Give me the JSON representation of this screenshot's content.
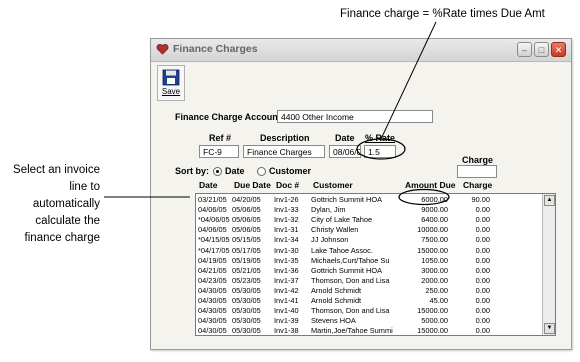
{
  "callouts": {
    "top": "Finance charge = %Rate times Due Amt",
    "left": [
      "Select an invoice",
      "line to",
      "automatically",
      "calculate the",
      "finance charge"
    ]
  },
  "window": {
    "title": "Finance Charges",
    "save_label": "Save"
  },
  "form": {
    "account_label": "Finance Charge Account*",
    "account_value": "4400   Other Income",
    "ref_label": "Ref #",
    "desc_label": "Description",
    "date_label": "Date",
    "rate_label": "% Rate",
    "ref_value": "FC-9",
    "desc_value": "Finance Charges",
    "date_value": "08/06/0",
    "rate_value": "1.5",
    "charge_label": "Charge",
    "charge_value": ""
  },
  "sort": {
    "label": "Sort by:",
    "option_date": "Date",
    "option_customer": "Customer",
    "selected": "Date"
  },
  "table": {
    "headers": [
      "Date",
      "Due Date",
      "Doc #",
      "Customer",
      "Amount Due",
      "Charge"
    ],
    "rows": [
      [
        "03/21/05",
        "04/20/05",
        "Inv1-26",
        "Gottrich Summit HOA",
        "6000.00",
        "90.00"
      ],
      [
        "04/06/05",
        "05/06/05",
        "Inv1-33",
        "Dylan, Jim",
        "9000.00",
        "0.00"
      ],
      [
        "*04/06/05",
        "05/06/05",
        "Inv1-32",
        "City of Lake Tahoe",
        "6400.00",
        "0.00"
      ],
      [
        "04/06/05",
        "05/06/05",
        "Inv1-31",
        "Christy Wallen",
        "10000.00",
        "0.00"
      ],
      [
        "*04/15/05",
        "05/15/05",
        "Inv1-34",
        "JJ Johnson",
        "7500.00",
        "0.00"
      ],
      [
        "*04/17/05",
        "05/17/05",
        "Inv1-30",
        "Lake Tahoe Assoc.",
        "15000.00",
        "0.00"
      ],
      [
        "04/19/05",
        "05/19/05",
        "Inv1-35",
        "Michaels,Curt/Tahoe Su",
        "1050.00",
        "0.00"
      ],
      [
        "04/21/05",
        "05/21/05",
        "Inv1-36",
        "Gottrich Summit HOA",
        "3000.00",
        "0.00"
      ],
      [
        "04/23/05",
        "05/23/05",
        "Inv1-37",
        "Thomson, Don and Lisa",
        "2000.00",
        "0.00"
      ],
      [
        "04/30/05",
        "05/30/05",
        "Inv1-42",
        "Arnold Schmidt",
        "250.00",
        "0.00"
      ],
      [
        "04/30/05",
        "05/30/05",
        "Inv1-41",
        "Arnold Schmidt",
        "45.00",
        "0.00"
      ],
      [
        "04/30/05",
        "05/30/05",
        "Inv1-40",
        "Thomson, Don and Lisa",
        "15000.00",
        "0.00"
      ],
      [
        "04/30/05",
        "05/30/05",
        "Inv1-39",
        "Stevens HOA",
        "5000.00",
        "0.00"
      ],
      [
        "04/30/05",
        "05/30/05",
        "Inv1-38",
        "Martin,Joe/Tahoe Summi",
        "15000.00",
        "0.00"
      ]
    ]
  }
}
